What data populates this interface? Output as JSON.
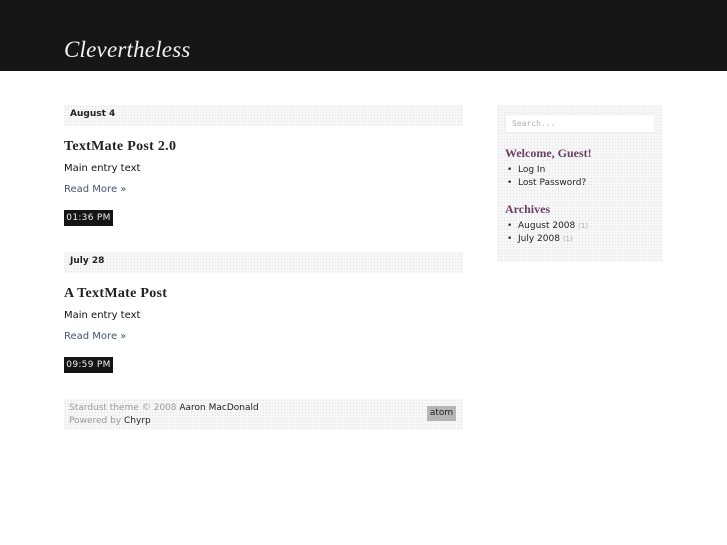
{
  "header": {
    "site_title": "Clevertheless"
  },
  "posts": [
    {
      "date": "August 4",
      "title": "TextMate Post 2.0",
      "body": "Main entry text",
      "read_more": "Read More »",
      "time": "01:36 PM"
    },
    {
      "date": "July 28",
      "title": "A TextMate Post",
      "body": "Main entry text",
      "read_more": "Read More »",
      "time": "09:59 PM"
    }
  ],
  "footer": {
    "theme_prefix": "Stardust theme © 2008 ",
    "theme_author": "Aaron MacDonald",
    "powered_prefix": "Powered by ",
    "powered_link": "Chyrp",
    "feed_label": "atom"
  },
  "sidebar": {
    "search_placeholder": "Search...",
    "welcome_heading": "Welcome, Guest!",
    "account_links": [
      "Log In",
      "Lost Password?"
    ],
    "archives_heading": "Archives",
    "archives": [
      {
        "label": "August 2008",
        "count": "(1)"
      },
      {
        "label": "July 2008",
        "count": "(1)"
      }
    ]
  }
}
